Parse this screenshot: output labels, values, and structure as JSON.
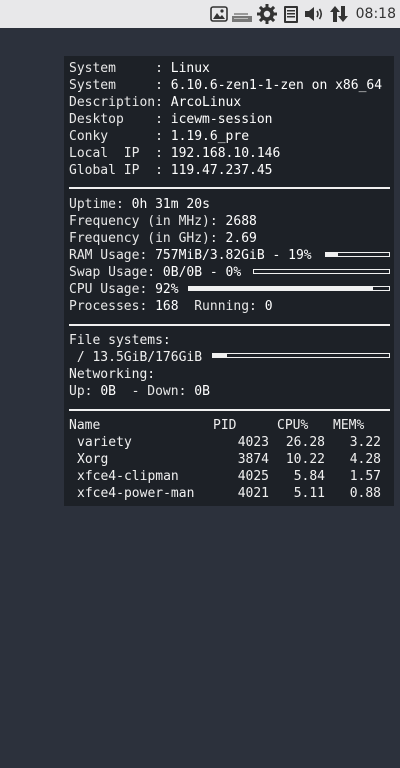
{
  "panel": {
    "clock": "08:18",
    "tray_icons": [
      "image-viewer-icon",
      "drive-icon",
      "settings-icon",
      "clipboard-icon",
      "volume-icon",
      "network-transfer-icon"
    ]
  },
  "info": {
    "rows": [
      {
        "label": "System     : ",
        "value": "Linux"
      },
      {
        "label": "System     : ",
        "value": "6.10.6-zen1-1-zen on x86_64"
      },
      {
        "label": "Description: ",
        "value": "ArcoLinux"
      },
      {
        "label": "Desktop    : ",
        "value": "icewm-session"
      },
      {
        "label": "Conky      : ",
        "value": "1.19.6_pre"
      },
      {
        "label": "Local  IP  : ",
        "value": "192.168.10.146"
      },
      {
        "label": "Global IP  : ",
        "value": "119.47.237.45"
      }
    ]
  },
  "stats": {
    "uptime_label": "Uptime: ",
    "uptime": "0h 31m 20s",
    "freq_mhz_label": "Frequency (in MHz): ",
    "freq_mhz": "2688",
    "freq_ghz_label": "Frequency (in GHz): ",
    "freq_ghz": "2.69",
    "ram_label": "RAM Usage: ",
    "ram": "757MiB/3.82GiB - 19%",
    "ram_pct": 19,
    "swap_label": "Swap Usage: ",
    "swap": "0B/0B - 0%",
    "swap_pct": 0,
    "cpu_label": "CPU Usage: ",
    "cpu": "92%",
    "cpu_pct": 92,
    "processes_label": "Processes: ",
    "processes": "168",
    "running_label": "Running: ",
    "running": "0"
  },
  "fs": {
    "title": "File systems:",
    "root": " / 13.5GiB/176GiB",
    "root_pct": 7.7,
    "net_title": "Networking:",
    "up_label": "Up: ",
    "up": "0B",
    "down_label": "  - Down: ",
    "down": "0B"
  },
  "procs": {
    "headers": {
      "name": "Name",
      "pid": "PID",
      "cpu": "CPU%",
      "mem": "MEM%"
    },
    "rows": [
      {
        "name": "variety",
        "pid": "4023",
        "cpu": "26.28",
        "mem": "3.22"
      },
      {
        "name": "Xorg",
        "pid": "3874",
        "cpu": "10.22",
        "mem": "4.28"
      },
      {
        "name": "xfce4-clipman",
        "pid": "4025",
        "cpu": "5.84",
        "mem": "1.57"
      },
      {
        "name": "xfce4-power-man",
        "pid": "4021",
        "cpu": "5.11",
        "mem": "0.88"
      }
    ]
  }
}
